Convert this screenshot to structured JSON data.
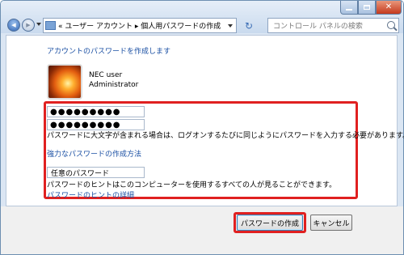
{
  "window": {
    "controls": {
      "minimize_icon": "minimize-icon",
      "maximize_icon": "maximize-icon",
      "close_icon": "close-icon"
    }
  },
  "nav": {
    "back_glyph": "◀",
    "forward_glyph": "▶",
    "address_path": "« ユーザー アカウント ▸ 個人用パスワードの作成",
    "refresh_glyph": "↻",
    "search_placeholder": "コントロール パネルの検索"
  },
  "main": {
    "heading": "アカウントのパスワードを作成します",
    "user": {
      "name": "NEC user",
      "role": "Administrator"
    },
    "password_value": "●●●●●●●●●",
    "confirm_value": "●●●●●●●●●",
    "case_note": "パスワードに大文字が含まれる場合は、ログオンするたびに同じようにパスワードを入力する必要があります。",
    "strong_password_link": "強力なパスワードの作成方法",
    "hint_value": "任意のパスワード",
    "hint_note": "パスワードのヒントはこのコンピューターを使用するすべての人が見ることができます。",
    "hint_link": "パスワードのヒントの詳細"
  },
  "footer": {
    "create_button": "パスワードの作成",
    "cancel_button": "キャンセル"
  },
  "colors": {
    "highlight": "#e02020",
    "link": "#1a4fa3"
  }
}
